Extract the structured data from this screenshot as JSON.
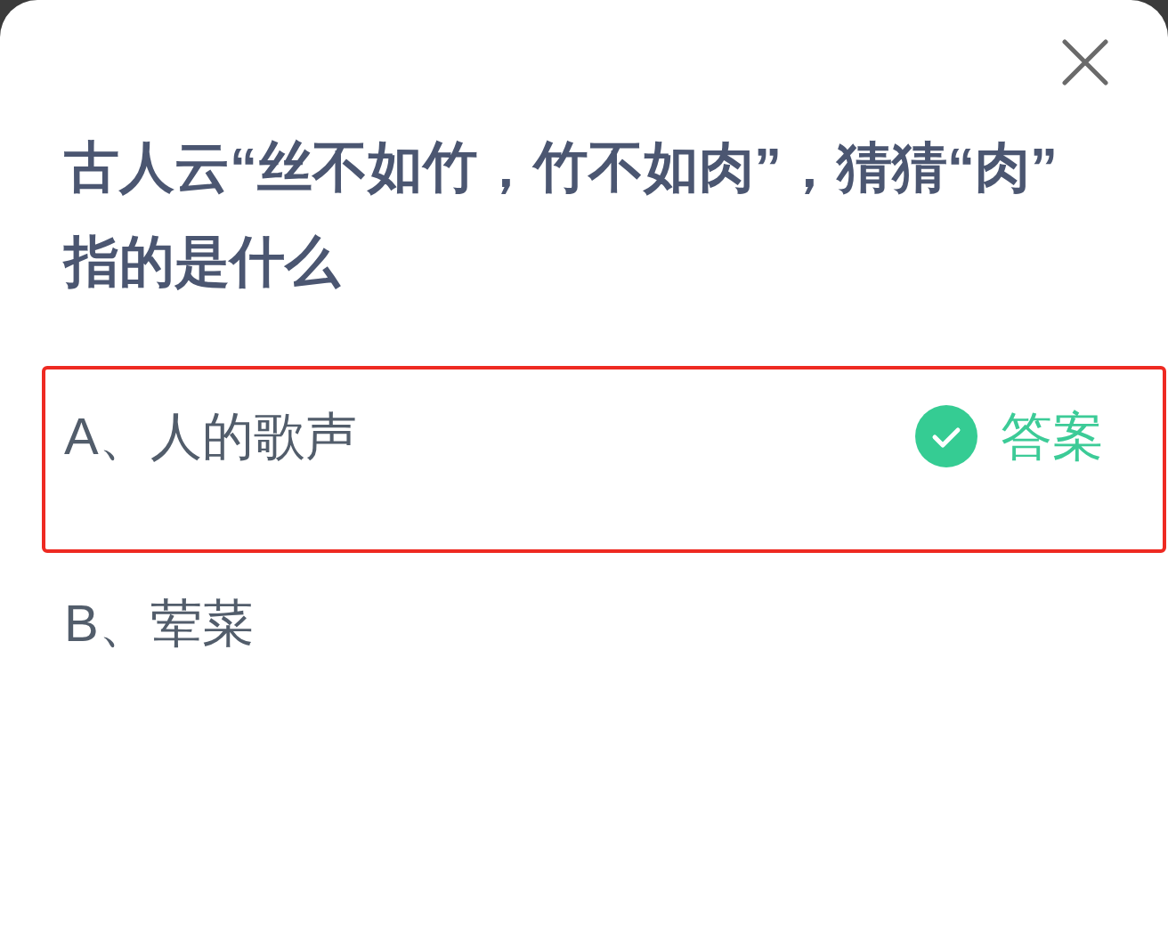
{
  "question": "古人云“丝不如竹，竹不如肉”，猜猜“肉”指的是什么",
  "options": [
    {
      "text": "A、人的歌声",
      "correct": true,
      "badge": "答案",
      "highlighted": true
    },
    {
      "text": "B、荤菜",
      "correct": false,
      "highlighted": false
    }
  ]
}
